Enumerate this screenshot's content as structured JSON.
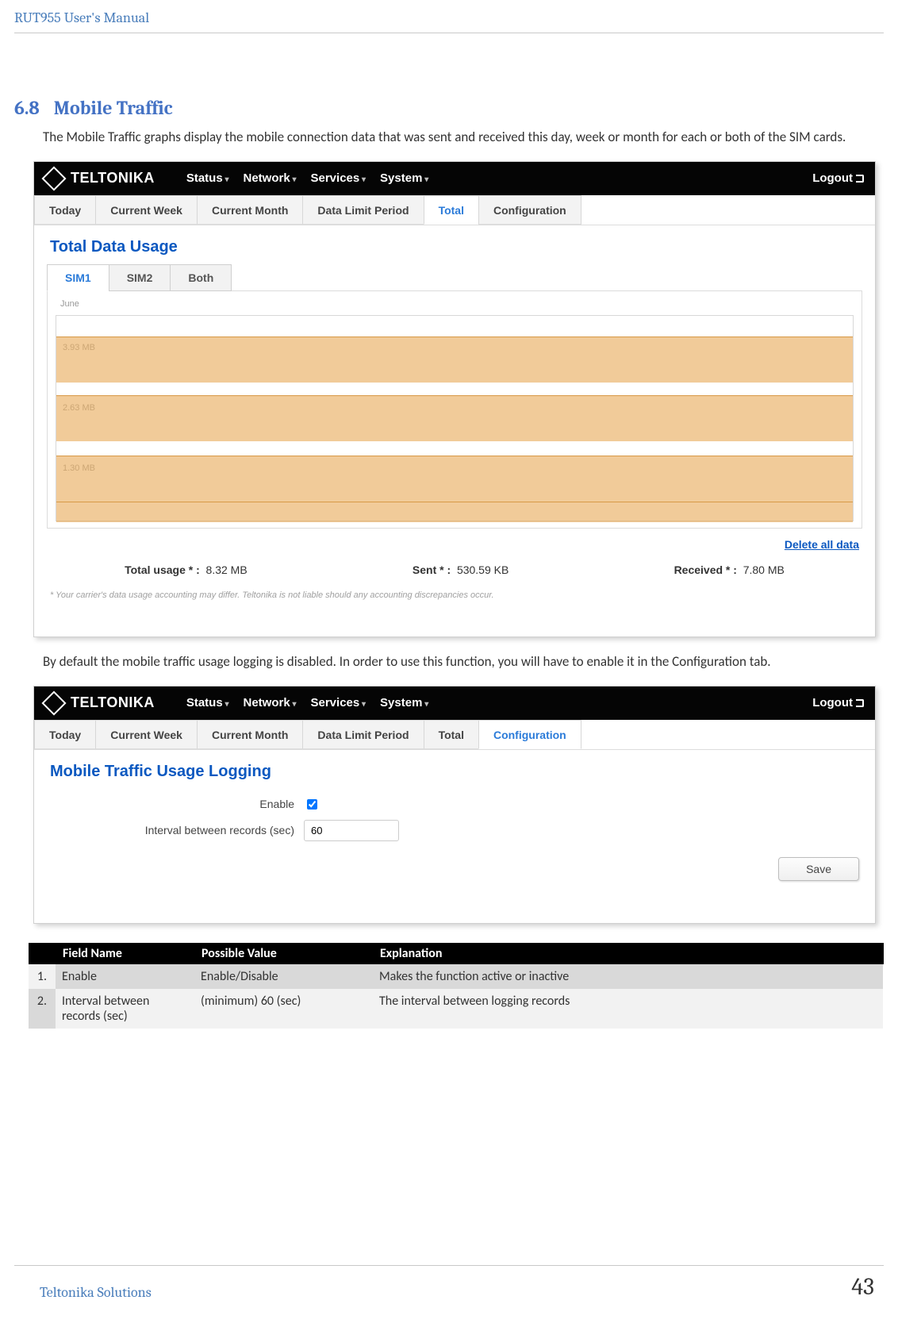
{
  "doc_title": "RUT955 User's Manual",
  "section": {
    "num": "6.8",
    "title": "Mobile Traffic"
  },
  "para1": "The Mobile Traffic graphs display the mobile connection data that was sent and received this day, week or month for each or both of the SIM cards.",
  "para2": "By default the mobile traffic usage logging is disabled.  In order to use this function, you will have to enable it in the Configuration tab.",
  "ui": {
    "logo": "TELTONIKA",
    "nav": [
      "Status",
      "Network",
      "Services",
      "System"
    ],
    "logout": "Logout",
    "time_tabs": [
      "Today",
      "Current Week",
      "Current Month",
      "Data Limit Period",
      "Total",
      "Configuration"
    ],
    "active_time_tab_1": "Total",
    "active_time_tab_2": "Configuration",
    "panel_title_1": "Total Data Usage",
    "panel_title_2": "Mobile Traffic Usage Logging",
    "sim_tabs": [
      "SIM1",
      "SIM2",
      "Both"
    ],
    "active_sim_tab": "SIM1",
    "month": "June",
    "ylabels": [
      "3.93 MB",
      "2.63 MB",
      "1.30 MB"
    ],
    "delete": "Delete all data",
    "stats": {
      "total_label": "Total usage * :",
      "total_value": "8.32 MB",
      "sent_label": "Sent * :",
      "sent_value": "530.59 KB",
      "recv_label": "Received * :",
      "recv_value": "7.80 MB"
    },
    "footnote": "* Your carrier's data usage accounting may differ. Teltonika is not liable should any accounting discrepancies occur.",
    "form": {
      "enable_label": "Enable",
      "enable_checked": true,
      "interval_label": "Interval between records (sec)",
      "interval_value": "60",
      "save": "Save"
    }
  },
  "table": {
    "headers": [
      "",
      "Field Name",
      "Possible Value",
      "Explanation"
    ],
    "rows": [
      {
        "n": "1.",
        "name": "Enable",
        "value": "Enable/Disable",
        "expl": "Makes the function active or inactive"
      },
      {
        "n": "2.",
        "name": "Interval between records (sec)",
        "value": "(minimum) 60 (sec)",
        "expl": "The interval between logging records"
      }
    ]
  },
  "footer": {
    "brand": "Teltonika Solutions",
    "page": "43"
  }
}
